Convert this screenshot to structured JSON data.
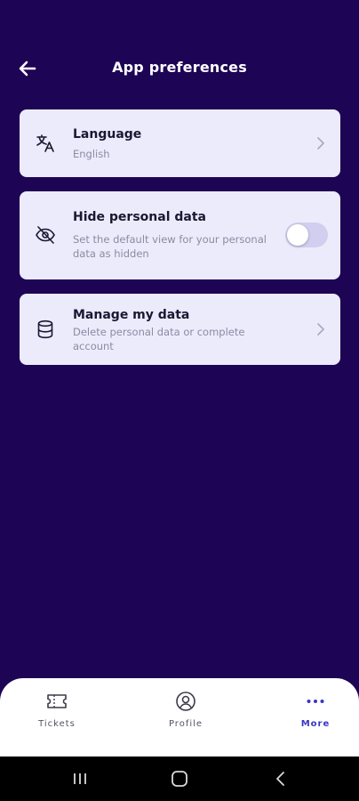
{
  "header": {
    "title": "App preferences",
    "back_icon": "arrow-left-icon"
  },
  "settings": [
    {
      "title": "Language",
      "subtitle": "English",
      "icon": "translate-icon",
      "control": "chevron"
    },
    {
      "title": "Hide personal data",
      "subtitle": "Set the default view for your personal data as hidden",
      "icon": "eye-off-icon",
      "control": "toggle",
      "toggle_on": false
    },
    {
      "title": "Manage my data",
      "subtitle": "Delete personal data or complete account",
      "icon": "database-icon",
      "control": "chevron"
    }
  ],
  "bottom_nav": {
    "items": [
      {
        "label": "Tickets",
        "icon": "ticket-icon",
        "active": false
      },
      {
        "label": "Profile",
        "icon": "user-circle-icon",
        "active": false
      },
      {
        "label": "More",
        "icon": "more-dots-icon",
        "active": true
      }
    ]
  },
  "colors": {
    "background": "#1d0454",
    "card": "#ecebfb",
    "accent": "#3a36c4",
    "toggle_track": "#d1ceef"
  }
}
